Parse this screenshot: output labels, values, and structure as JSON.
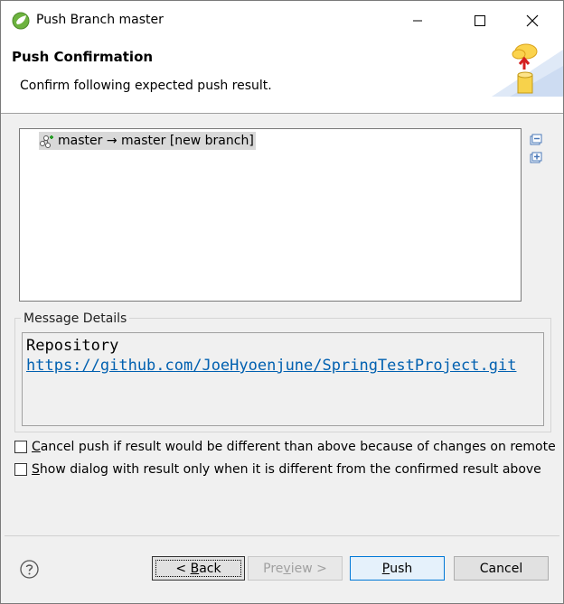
{
  "window": {
    "title": "Push Branch master"
  },
  "header": {
    "title": "Push Confirmation",
    "description": "Confirm following expected push result."
  },
  "results": {
    "items": [
      {
        "label": "master → master [new branch]"
      }
    ]
  },
  "message_details": {
    "label": "Message Details",
    "repository_label": "Repository",
    "url": "https://github.com/JoeHyoenjune/SpringTestProject.git"
  },
  "options": {
    "cancel_if_different": {
      "mnemonic": "C",
      "rest": "ancel push if result would be different than above because of changes on remote",
      "checked": false
    },
    "show_dialog_only_if_different": {
      "mnemonic": "S",
      "rest": "how dialog with result only when it is different from the confirmed result above",
      "checked": false
    }
  },
  "buttons": {
    "back": {
      "prefix": "< ",
      "mnemonic": "B",
      "rest": "ack"
    },
    "preview": {
      "prefix": "Pre",
      "mnemonic": "v",
      "rest": "iew >"
    },
    "push": {
      "mnemonic": "P",
      "rest": "ush"
    },
    "cancel": "Cancel"
  },
  "colors": {
    "accent_blue": "#0078d7",
    "link": "#0060b0"
  }
}
